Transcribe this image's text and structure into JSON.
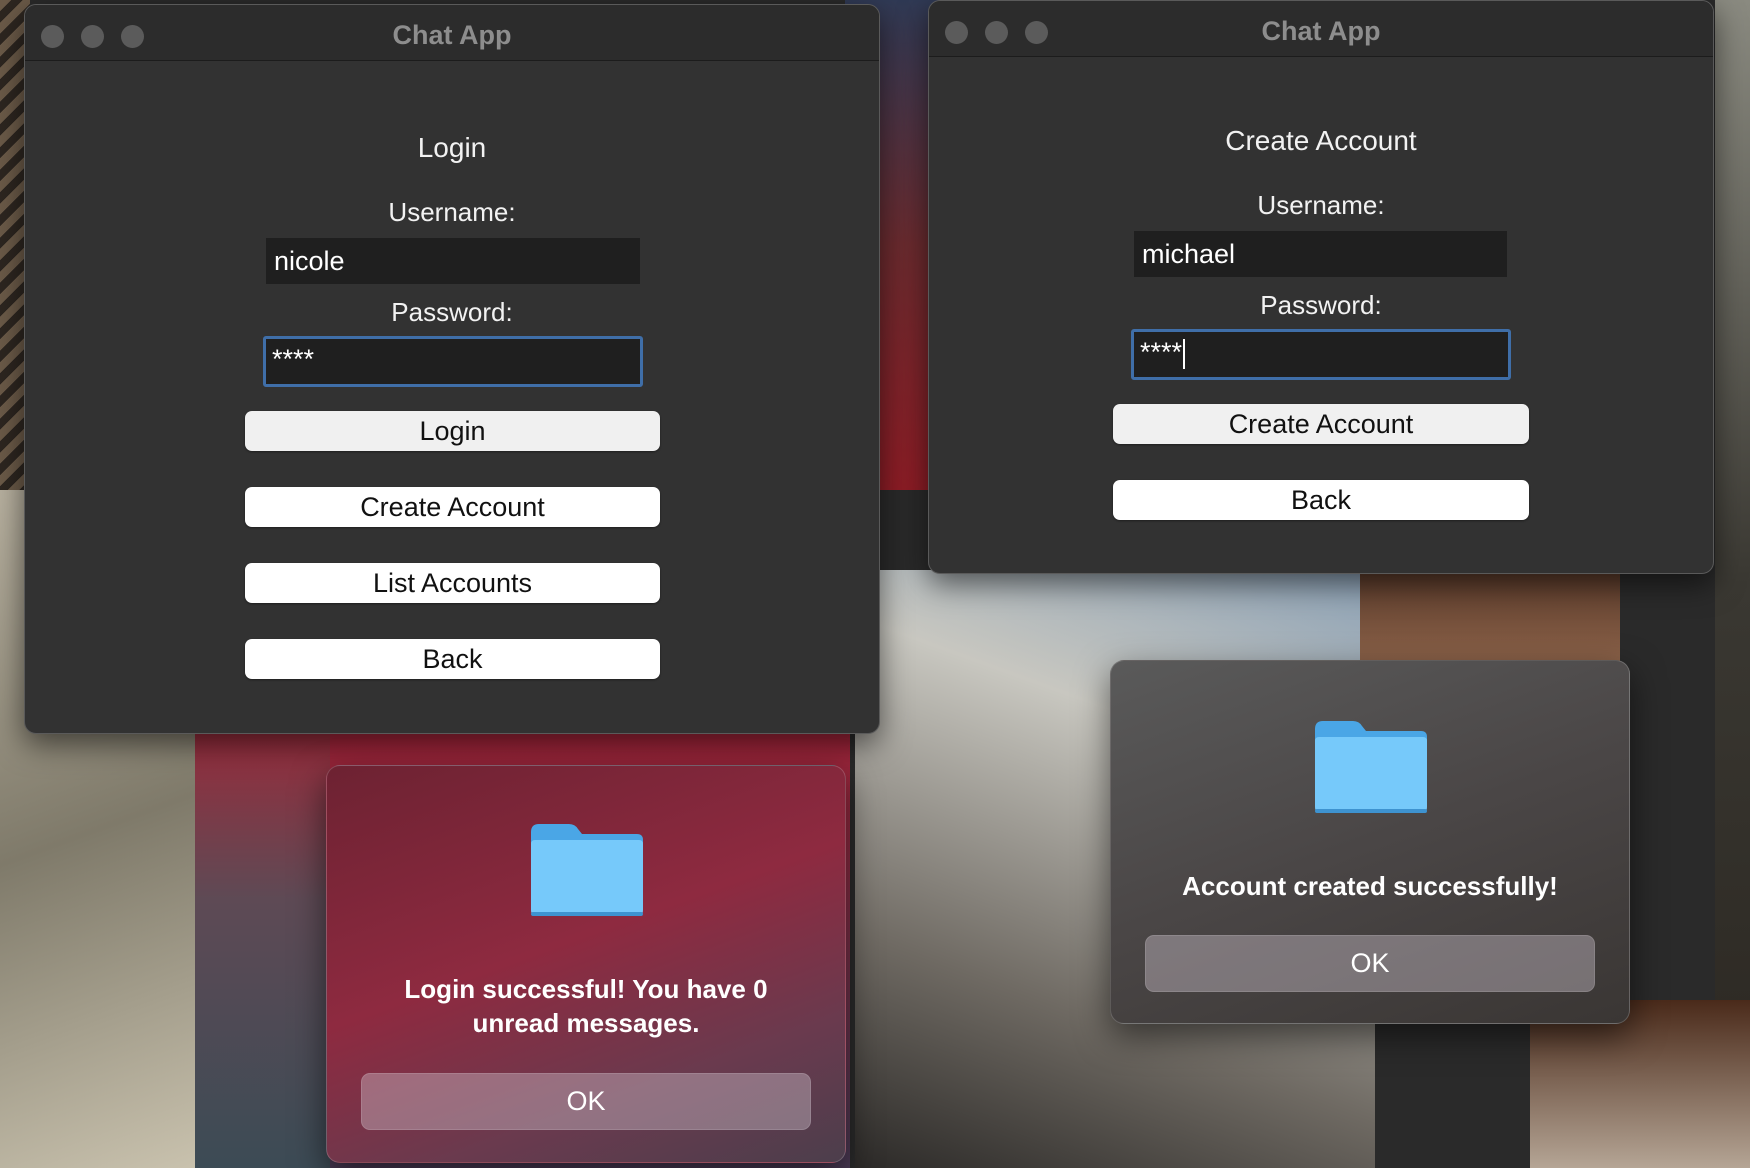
{
  "windows": {
    "login": {
      "title": "Chat App",
      "heading": "Login",
      "username_label": "Username:",
      "username_value": "nicole",
      "password_label": "Password:",
      "password_value": "****",
      "buttons": {
        "login": "Login",
        "create_account": "Create Account",
        "list_accounts": "List Accounts",
        "back": "Back"
      }
    },
    "create_account": {
      "title": "Chat App",
      "heading": "Create Account",
      "username_label": "Username:",
      "username_value": "michael",
      "password_label": "Password:",
      "password_value": "****",
      "buttons": {
        "create_account": "Create Account",
        "back": "Back"
      }
    }
  },
  "alerts": {
    "login_success": {
      "icon": "folder-icon",
      "message_line1": "Login successful! You have 0",
      "message_line2": "unread messages.",
      "ok_label": "OK"
    },
    "account_created": {
      "icon": "folder-icon",
      "message": "Account created successfully!",
      "ok_label": "OK"
    }
  },
  "colors": {
    "window_bg": "#323232",
    "focus_ring": "#3f6ea8",
    "folder_blue": "#6fc3f7"
  }
}
